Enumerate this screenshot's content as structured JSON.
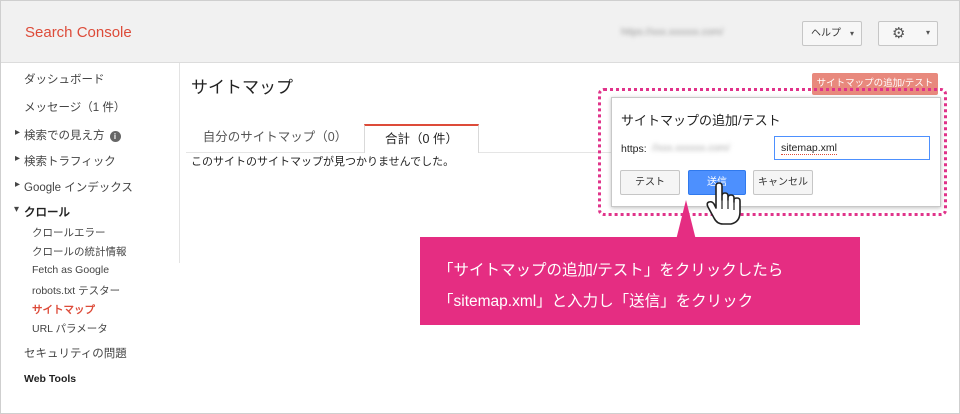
{
  "header": {
    "brand": "Search Console",
    "account": "https://xxx.xxxxxx.com/",
    "help_label": "ヘルプ",
    "help_caret": "▾",
    "gear_glyph": "⚙",
    "gear_caret": "▾"
  },
  "sidebar": {
    "items": [
      {
        "label": "ダッシュボード"
      },
      {
        "label": "メッセージ（1 件）"
      },
      {
        "label": "検索での見え方"
      },
      {
        "label": "検索トラフィック"
      },
      {
        "label": "Google インデックス"
      },
      {
        "label": "クロール"
      }
    ],
    "info_glyph": "i",
    "crawl_sub": [
      {
        "label": "クロールエラー"
      },
      {
        "label": "クロールの統計情報"
      },
      {
        "label": "Fetch as Google"
      },
      {
        "label": "robots.txt テスター"
      },
      {
        "label": "サイトマップ"
      },
      {
        "label": "URL パラメータ"
      }
    ],
    "security": "セキュリティの問題",
    "web_tools": "Web Tools"
  },
  "main": {
    "title": "サイトマップ",
    "tabs": [
      {
        "label": "自分のサイトマップ（0）"
      },
      {
        "label": "合計（0 件）"
      }
    ],
    "empty_message": "このサイトのサイトマップが見つかりませんでした。",
    "add_test_label": "サイトマップの追加/テスト"
  },
  "dialog": {
    "title": "サイトマップの追加/テスト",
    "prefix": "https:",
    "domain": "//xxx.xxxxxx.com/",
    "input_value": "sitemap.xml",
    "test_label": "テスト",
    "send_label": "送信",
    "cancel_label": "キャンセル"
  },
  "callout": {
    "line1": "「サイトマップの追加/テスト」をクリックしたら",
    "line2": "「sitemap.xml」と入力し「送信」をクリック",
    "color": "#e52d82"
  },
  "colors": {
    "brand": "#dd4b39",
    "accent_blue": "#4d90fe",
    "highlight": "#e0338a"
  }
}
